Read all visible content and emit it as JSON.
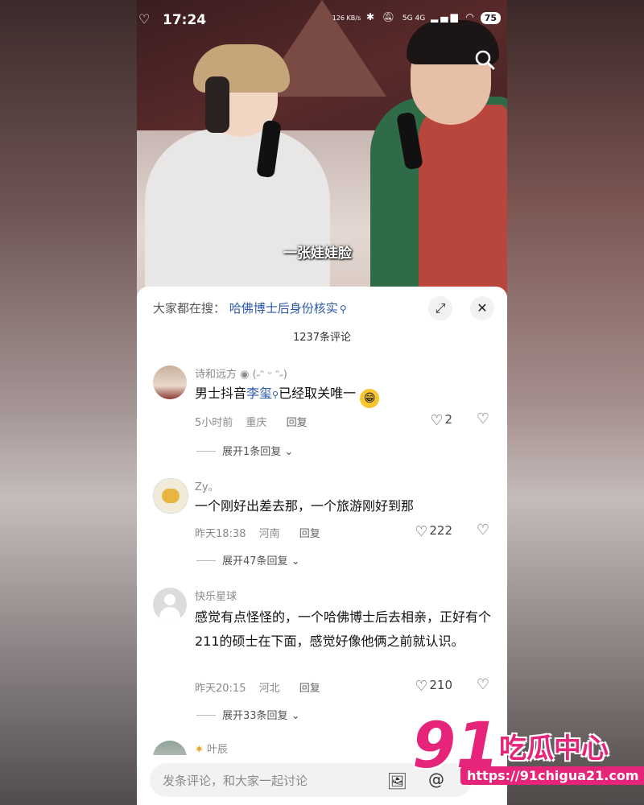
{
  "status_bar": {
    "time": "17:24",
    "net_speed": "126 KB/s",
    "signal": "5G 4G",
    "battery": "75"
  },
  "video": {
    "caption": "一张娃娃脸"
  },
  "sheet": {
    "trending_prefix": "大家都在搜：",
    "trending_query": "哈佛博士后身份核实",
    "comment_count": "1237条评论"
  },
  "comments": [
    {
      "username": "诗和远方",
      "username_suffix": "(˶ᵔ ᵕ ᵔ˶)",
      "content_before": "男士抖音",
      "content_highlight": "李玺",
      "content_after": "已经取关唯一",
      "time": "5小时前",
      "location": "重庆",
      "reply_label": "回复",
      "likes": "2",
      "expand_label": "展开1条回复"
    },
    {
      "username": "Zy。",
      "content": "一个刚好出差去那，一个旅游刚好到那",
      "time": "昨天18:38",
      "location": "河南",
      "reply_label": "回复",
      "likes": "222",
      "expand_label": "展开47条回复"
    },
    {
      "username": "快乐星球",
      "content": "感觉有点怪怪的，一个哈佛博士后去相亲，正好有个211的硕士在下面，感觉好像他俩之前就认识。",
      "time": "昨天20:15",
      "location": "河北",
      "reply_label": "回复",
      "likes": "210",
      "expand_label": "展开33条回复"
    },
    {
      "username": "叶辰"
    }
  ],
  "input": {
    "placeholder": "发条评论，和大家一起讨论"
  },
  "watermark": {
    "number": "91",
    "name": "吃瓜中心",
    "url": "https://91chigua21.com"
  },
  "colors": {
    "link_blue": "#2c5aa8",
    "brand_pink": "#e6247a"
  }
}
